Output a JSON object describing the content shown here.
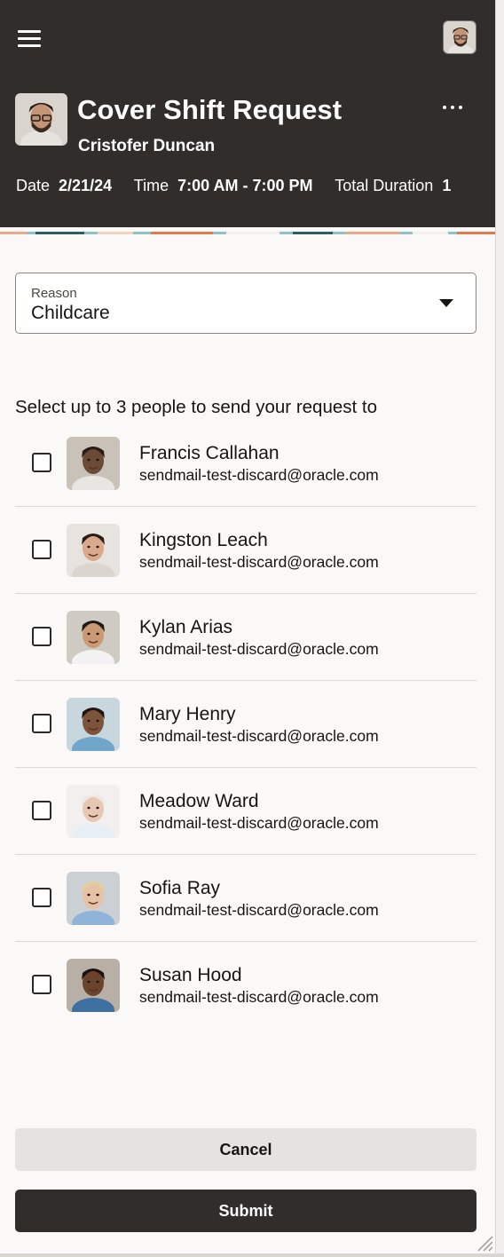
{
  "header": {
    "title": "Cover Shift Request",
    "employee_name": "Cristofer Duncan",
    "meta": [
      {
        "label": "Date",
        "value": "2/21/24"
      },
      {
        "label": "Time",
        "value": "7:00 AM - 7:00 PM"
      },
      {
        "label": "Total Duration",
        "value": "1"
      }
    ]
  },
  "reason": {
    "label": "Reason",
    "value": "Childcare"
  },
  "instruction": "Select up to 3 people to send your request to",
  "people": [
    {
      "name": "Francis Callahan",
      "email": "sendmail-test-discard@oracle.com",
      "skin": "#6b4a36",
      "hair": "#2a1c14",
      "bg": "#c9c2b8",
      "coat": "#e8e6e3",
      "checked": false
    },
    {
      "name": "Kingston Leach",
      "email": "sendmail-test-discard@oracle.com",
      "skin": "#d8a98a",
      "hair": "#2b1d16",
      "bg": "#e7e4e0",
      "coat": "#dad5cf",
      "checked": false
    },
    {
      "name": "Kylan Arias",
      "email": "sendmail-test-discard@oracle.com",
      "skin": "#c99a73",
      "hair": "#1e1a17",
      "bg": "#cfcac2",
      "coat": "#f2f2f2",
      "checked": false
    },
    {
      "name": "Mary Henry",
      "email": "sendmail-test-discard@oracle.com",
      "skin": "#7d533a",
      "hair": "#1f1612",
      "bg": "#c8d6de",
      "coat": "#6fa6c9",
      "checked": false
    },
    {
      "name": "Meadow Ward",
      "email": "sendmail-test-discard@oracle.com",
      "skin": "#e7c7b2",
      "hair": "#ece9e4",
      "bg": "#f1f0ee",
      "coat": "#e7eef4",
      "checked": false
    },
    {
      "name": "Sofia Ray",
      "email": "sendmail-test-discard@oracle.com",
      "skin": "#e6c2a6",
      "hair": "#e4cf98",
      "bg": "#cbd0d5",
      "coat": "#8fb4d8",
      "checked": false
    },
    {
      "name": "Susan Hood",
      "email": "sendmail-test-discard@oracle.com",
      "skin": "#6a432d",
      "hair": "#1a1210",
      "bg": "#b8b0a6",
      "coat": "#3f6fa0",
      "checked": false
    }
  ],
  "actions": {
    "cancel_label": "Cancel",
    "submit_label": "Submit"
  },
  "colors": {
    "header_bg": "#312d2a",
    "page_bg": "#faf9f8",
    "submit_bg": "#312d2a",
    "cancel_bg": "#e4e3e1"
  },
  "icons": [
    "hamburger-menu-icon",
    "more-options-icon",
    "chevron-down-icon",
    "resize-grip-icon"
  ]
}
